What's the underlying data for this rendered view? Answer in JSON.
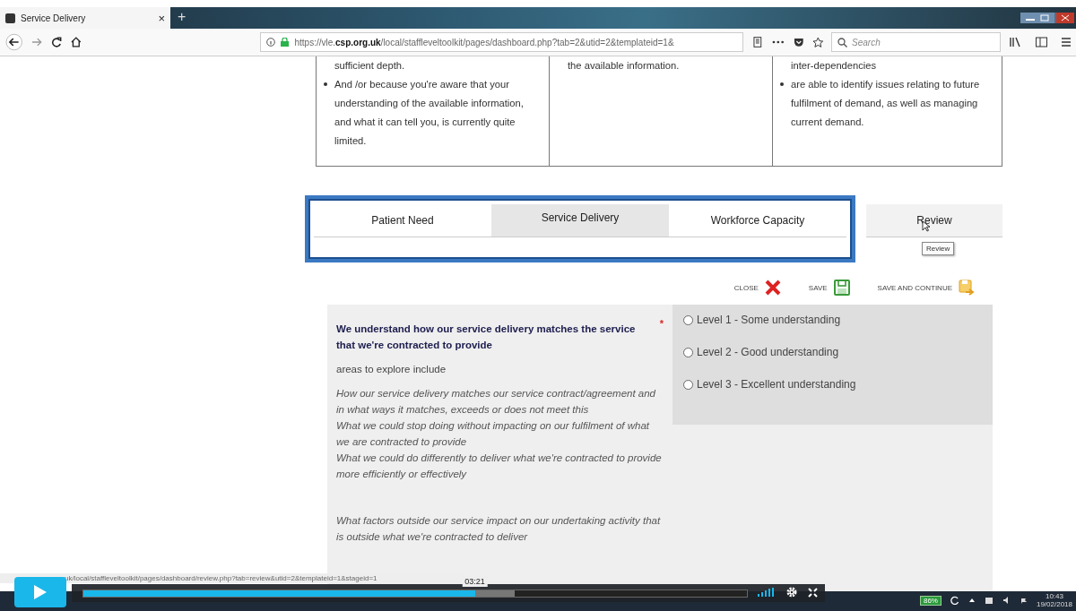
{
  "browser": {
    "tab_title": "Service Delivery",
    "tab_close": "×",
    "new_tab": "+",
    "url": "https://vle.**csp.org.uk**/local/staffleveltoolkit/pages/dashboard.php?tab=2&utid=2&templateid=1&",
    "search_placeholder": "Search"
  },
  "descriptors": [
    {
      "lines": [
        {
          "text": "sufficient depth.",
          "bullet": false
        },
        {
          "text": "And /or because you're aware that your understanding of the available information, and what it can tell you, is currently quite limited.",
          "bullet": true
        }
      ]
    },
    {
      "lines": [
        {
          "text": "the available information.",
          "bullet": false
        }
      ]
    },
    {
      "lines": [
        {
          "text": "inter-dependencies",
          "bullet": false
        },
        {
          "text": "are able to identify issues relating to future fulfilment of demand, as well as managing current demand.",
          "bullet": true
        }
      ]
    }
  ],
  "highlighted_tabs": [
    {
      "label": "Patient Need",
      "selected": false,
      "hovered": false
    },
    {
      "label": "Service Delivery",
      "selected": true,
      "hovered": false
    },
    {
      "label": "Workforce Capacity",
      "selected": false,
      "hovered": false
    }
  ],
  "other_tabs": [
    {
      "label": "Review",
      "selected": false,
      "hovered": true,
      "tooltip": "Review"
    }
  ],
  "actions": [
    {
      "kind": "close",
      "label": "CLOSE"
    },
    {
      "kind": "save",
      "label": "SAVE"
    },
    {
      "kind": "save_continue",
      "label": "SAVE AND CONTINUE"
    }
  ],
  "question": {
    "title": "We understand how our service delivery matches the service that we're contracted to provide",
    "required_mark": "*",
    "subtitle": "areas to explore include",
    "prompt_groups": [
      [
        "How our service delivery matches our service contract/agreement and in what ways it matches, exceeds or does not meet this",
        "What we could stop doing without impacting on our fulfilment of what we are contracted to provide",
        "What we could do differently to deliver what we're contracted to provide more efficiently or effectively"
      ],
      [
        "What factors outside our service impact on our undertaking activity that is outside what we're contracted to deliver"
      ]
    ],
    "options": [
      {
        "label": "Level 1 - Some understanding",
        "selected": false
      },
      {
        "label": "Level 2 - Good understanding",
        "selected": false
      },
      {
        "label": "Level 3 - Excellent understanding",
        "selected": false
      }
    ]
  },
  "status_url": "uk/local/staffleveltoolkit/pages/dashboard/review.php?tab=review&utid=2&templateid=1&stageid=1",
  "video": {
    "level": 0.59,
    "buffer": {
      "level": 0.65
    },
    "time": "03:21"
  },
  "taskbar": {
    "battery": "86%",
    "time": "10:43",
    "date": "19/02/2018"
  }
}
